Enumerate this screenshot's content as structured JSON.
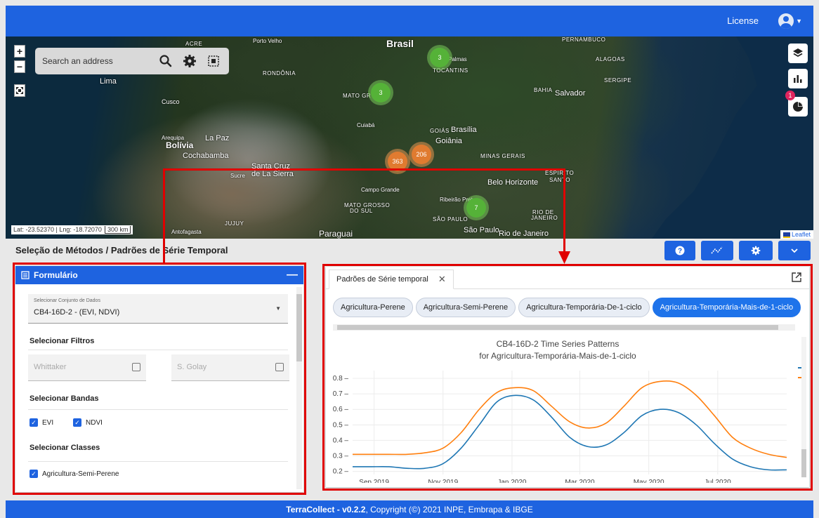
{
  "header": {
    "license_label": "License"
  },
  "map": {
    "search_placeholder": "Search an address",
    "coords_text": "Lat: -23.52370 | Lng: -18.72070",
    "scale_text": "300 km",
    "attribution": "Leaflet",
    "notification_count": "1",
    "labels": {
      "brasil": "Brasil",
      "bolivia": "Bolívia",
      "paraguai": "Paraguai",
      "lima": "Lima",
      "la_paz": "La Paz",
      "cochabamba": "Cochabamba",
      "santa_cruz_1": "Santa Cruz",
      "santa_cruz_2": "de La Sierra",
      "sucre": "Sucre",
      "cusco": "Cusco",
      "arequipa": "Arequipa",
      "acre": "ACRE",
      "porto_velho": "Porto Velho",
      "rondonia": "RONDÔNIA",
      "mato_grosso": "MATO GR",
      "cuiaba": "Cuiabá",
      "palmas": "Palmas",
      "tocantins": "TOCANTINS",
      "goias": "GOIÁS",
      "brasilia": "Brasília",
      "goiania": "Goiânia",
      "bahia": "BAHIA",
      "salvador": "Salvador",
      "sergipe": "SERGIPE",
      "alagoas": "ALAGOAS",
      "pernambuco": "PERNAMBUCO",
      "minas": "MINAS GERAIS",
      "belo": "Belo Horizonte",
      "espirito": "ESPÍRITO",
      "santo": "SANTO",
      "campo_grande": "Campo Grande",
      "ms_1": "MATO GROSSO",
      "ms_2": "DO SUL",
      "ribeirao": "Ribeirão Preto",
      "sao_paulo_state": "SÃO PAULO",
      "sao_paulo": "São Paulo",
      "rio": "Rio de Janeiro",
      "rj_1": "RIO DE",
      "rj_2": "JANEIRO",
      "jujuy": "JUJUY",
      "antofagasta": "Antofagasta"
    },
    "clusters": {
      "c1": "3",
      "c2": "3",
      "c3": "363",
      "c4": "206",
      "c5": "7"
    }
  },
  "section": {
    "title": "Seleção de Métodos / Padrões de Série Temporal"
  },
  "form": {
    "title": "Formulário",
    "dataset_label": "Selecionar Conjunto de Dados",
    "dataset_value": "CB4-16D-2 - (EVI, NDVI)",
    "filters_title": "Selecionar Filtros",
    "filter_1": "Whittaker",
    "filter_2": "S. Golay",
    "bands_title": "Selecionar Bandas",
    "band_1": "EVI",
    "band_2": "NDVI",
    "classes_title": "Selecionar Classes",
    "class_1": "Agricultura-Semi-Perene"
  },
  "chart_panel": {
    "tab_label": "Padrões de Série temporal",
    "chips": [
      "Agricultura-Perene",
      "Agricultura-Semi-Perene",
      "Agricultura-Temporária-De-1-ciclo",
      "Agricultura-Temporária-Mais-de-1-ciclo"
    ],
    "active_chip_index": 3
  },
  "footer": {
    "app": "TerraCollect - v0.2.2",
    "copyright": ", Copyright (©) 2021 INPE, Embrapa & IBGE"
  },
  "colors": {
    "primary": "#1e63e0",
    "evi": "#1f77b4",
    "ndvi": "#ff7f0e",
    "highlight": "#e00000"
  },
  "chart_data": {
    "type": "line",
    "title": "CB4-16D-2 Time Series Patterns",
    "subtitle": "for Agricultura-Temporária-Mais-de-1-ciclo",
    "x": [
      "2019-08-13",
      "2019-08-29",
      "2019-09-14",
      "2019-09-30",
      "2019-10-16",
      "2019-11-01",
      "2019-11-17",
      "2019-12-03",
      "2019-12-19",
      "2020-01-04",
      "2020-01-20",
      "2020-02-05",
      "2020-02-21",
      "2020-03-08",
      "2020-03-24",
      "2020-04-09",
      "2020-04-25",
      "2020-05-11",
      "2020-05-27",
      "2020-06-12",
      "2020-06-28",
      "2020-07-14",
      "2020-07-30",
      "2020-08-15",
      "2020-08-31"
    ],
    "x_tick_labels": [
      "Sep 2019",
      "Nov 2019",
      "Jan 2020",
      "Mar 2020",
      "May 2020",
      "Jul 2020"
    ],
    "x_tick_dates": [
      "2019-09-01",
      "2019-11-01",
      "2020-01-01",
      "2020-03-01",
      "2020-05-01",
      "2020-07-01"
    ],
    "ylim": [
      0.18,
      0.85
    ],
    "yticks": [
      0.2,
      0.3,
      0.4,
      0.5,
      0.6,
      0.7,
      0.8
    ],
    "grid": true,
    "legend": "right",
    "series": [
      {
        "values": [
          0.23,
          0.23,
          0.23,
          0.22,
          0.22,
          0.25,
          0.35,
          0.5,
          0.65,
          0.69,
          0.66,
          0.55,
          0.42,
          0.36,
          0.37,
          0.45,
          0.56,
          0.6,
          0.58,
          0.5,
          0.38,
          0.28,
          0.23,
          0.21,
          0.21
        ]
      },
      {
        "values": [
          0.31,
          0.31,
          0.31,
          0.31,
          0.32,
          0.35,
          0.45,
          0.6,
          0.71,
          0.74,
          0.72,
          0.62,
          0.52,
          0.48,
          0.51,
          0.62,
          0.74,
          0.78,
          0.77,
          0.69,
          0.56,
          0.42,
          0.35,
          0.31,
          0.29
        ]
      }
    ]
  }
}
